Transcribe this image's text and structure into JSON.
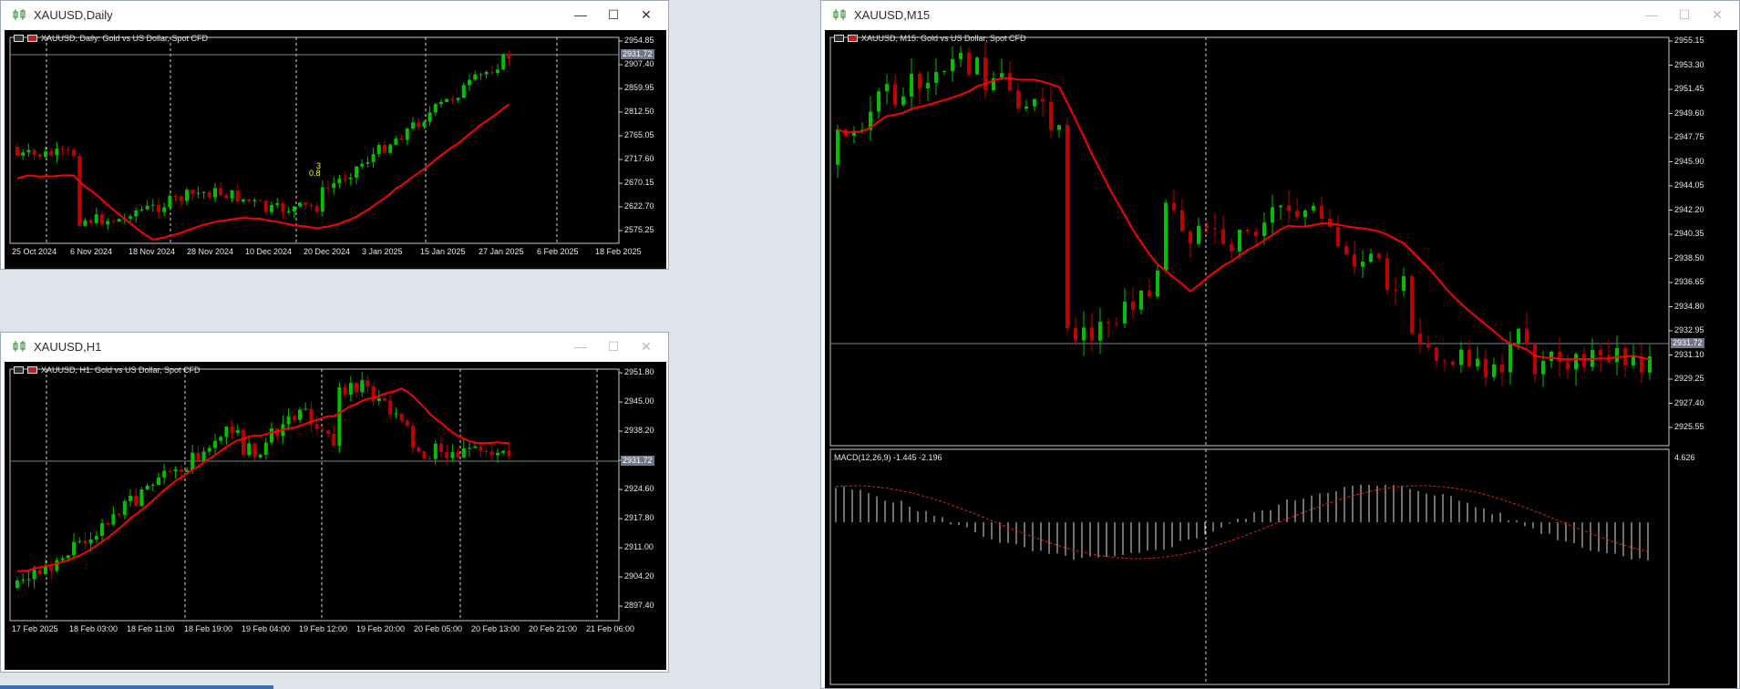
{
  "windows": {
    "daily": {
      "title": "XAUUSD,Daily",
      "symbol_desc": "XAUUSD, Daily:  Gold vs US Dollar, Spot CFD",
      "current_price": "2931.72",
      "price_axis": [
        "2954.85",
        "2907.40",
        "2859.95",
        "2812.50",
        "2765.05",
        "2717.60",
        "2670.15",
        "2622.70",
        "2575.25"
      ],
      "time_axis": [
        "25 Oct 2024",
        "6 Nov 2024",
        "18 Nov 2024",
        "28 Nov 2024",
        "10 Dec 2024",
        "20 Dec 2024",
        "3 Jan 2025",
        "15 Jan 2025",
        "27 Jan 2025",
        "6 Feb 2025",
        "18 Feb 2025"
      ],
      "fractal_up": "3",
      "fractal_dn": "0.8"
    },
    "h1": {
      "title": "XAUUSD,H1",
      "symbol_desc": "XAUUSD, H1:  Gold vs US Dollar, Spot CFD",
      "current_price": "2931.72",
      "price_axis": [
        "2951.80",
        "2945.00",
        "2938.20",
        "2931.72",
        "2924.60",
        "2917.80",
        "2911.00",
        "2904.20",
        "2897.40"
      ],
      "time_axis": [
        "17 Feb 2025",
        "18 Feb 03:00",
        "18 Feb 11:00",
        "18 Feb 19:00",
        "19 Feb 04:00",
        "19 Feb 12:00",
        "19 Feb 20:00",
        "20 Feb 05:00",
        "20 Feb 13:00",
        "20 Feb 21:00",
        "21 Feb 06:00"
      ]
    },
    "m15": {
      "title": "XAUUSD,M15",
      "symbol_desc": "XAUUSD, M15:  Gold vs US Dollar, Spot CFD",
      "current_price": "2931.72",
      "price_axis": [
        "2955.15",
        "2953.30",
        "2951.45",
        "2949.60",
        "2947.75",
        "2945.90",
        "2944.05",
        "2942.20",
        "2940.35",
        "2938.50",
        "2936.65",
        "2934.80",
        "2932.95",
        "2931.10",
        "2929.25",
        "2927.40",
        "2925.55"
      ],
      "macd_label": "MACD(12,26,9) -1.445 -2.196",
      "macd_axis_top": "4.626"
    }
  },
  "colors": {
    "bull": "#00c000",
    "bear": "#c00000",
    "ma": "#ff0000",
    "bg": "#000000",
    "grid": "#c8c8c8"
  },
  "icons": {
    "window_icon": "candlestick-icon",
    "minimize": "minimize-icon",
    "maximize": "maximize-icon",
    "close": "close-icon"
  }
}
